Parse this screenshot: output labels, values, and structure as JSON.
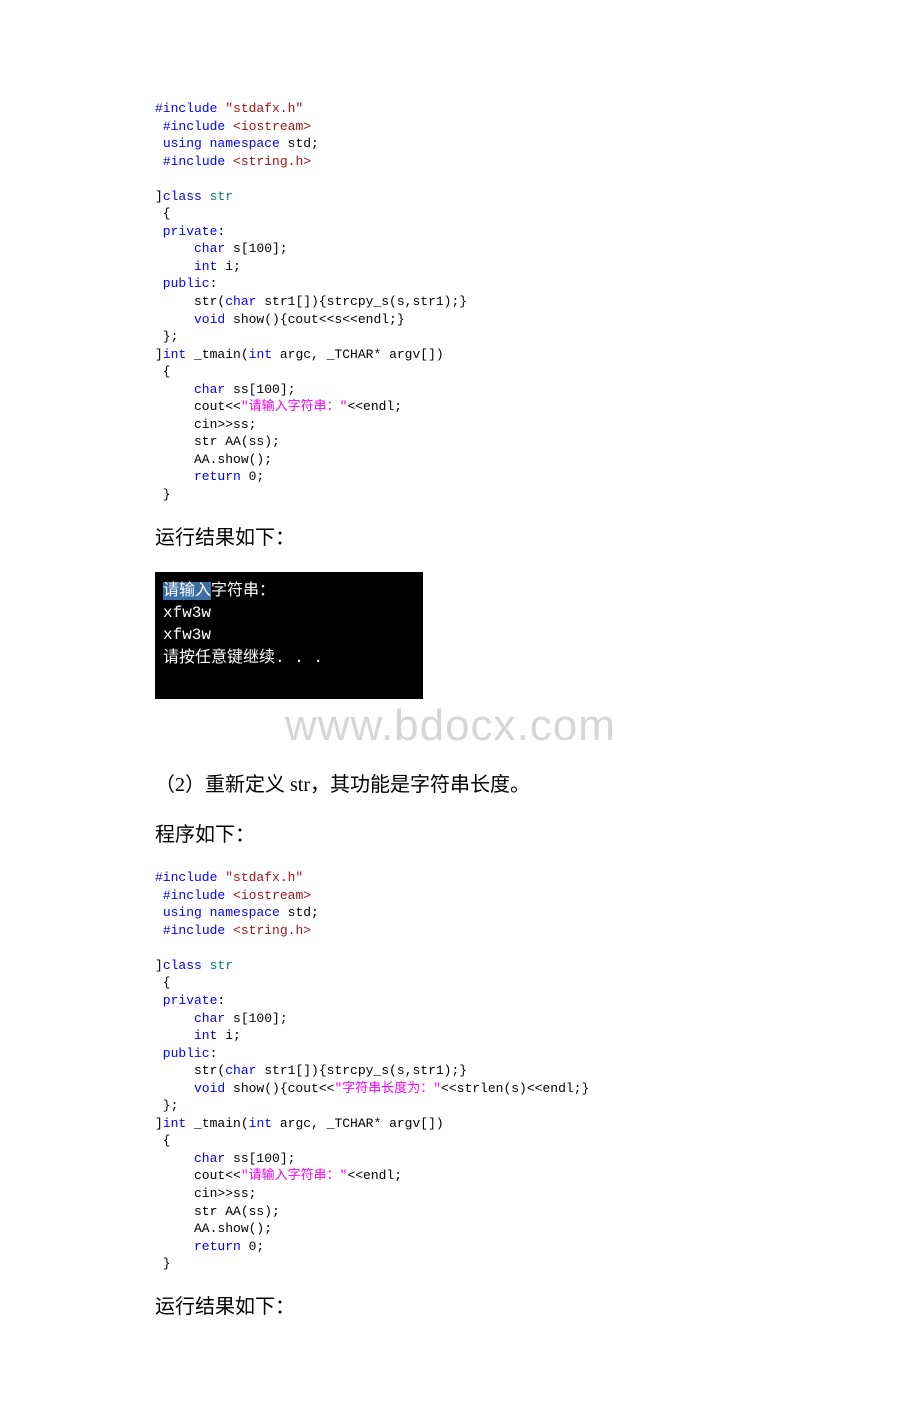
{
  "code1": {
    "l1_a": "#include",
    "l1_b": " \"stdafx.h\"",
    "l2_a": "#include",
    "l2_b": " <iostream>",
    "l3_a": "using namespace",
    "l3_b": " std;",
    "l4_a": "#include",
    "l4_b": " <string.h>",
    "l5": "",
    "l6_a": "class",
    "l6_b": " str",
    "l7": " {",
    "l8_a": " private",
    "l8_b": ":",
    "l9_a": "     char",
    "l9_b": " s[100];",
    "l10_a": "     int",
    "l10_b": " i;",
    "l11_a": " public",
    "l11_b": ":",
    "l12_a": "     str(",
    "l12_b": "char",
    "l12_c": " str1[]){strcpy_s(s,str1);}",
    "l13_a": "     void",
    "l13_b": " show(){cout<<s<<endl;}",
    "l14": " };",
    "l15_a": "int",
    "l15_b": " _tmain(",
    "l15_c": "int",
    "l15_d": " argc, _TCHAR* argv[])",
    "l16": " {",
    "l17_a": "     char",
    "l17_b": " ss[100];",
    "l18_a": "     cout<<",
    "l18_b": "\"请输入字符串：\"",
    "l18_c": "<<endl;",
    "l19": "     cin>>ss;",
    "l20": "     str AA(ss);",
    "l21": "     AA.show();",
    "l22_a": "     return",
    "l22_b": " 0;",
    "l23": " }"
  },
  "para1": "运行结果如下：",
  "console1": {
    "line1a": "请输入",
    "line1b": "字符串：",
    "line2": "xfw3w",
    "line3": "xfw3w",
    "line4": "请按任意键继续. . ."
  },
  "watermark": "www.bdocx.com",
  "para2": "（2）重新定义 str，其功能是字符串长度。",
  "para3": "程序如下：",
  "code2": {
    "l1_a": "#include",
    "l1_b": " \"stdafx.h\"",
    "l2_a": "#include",
    "l2_b": " <iostream>",
    "l3_a": "using namespace",
    "l3_b": " std;",
    "l4_a": "#include",
    "l4_b": " <string.h>",
    "l5": "",
    "l6_a": "class",
    "l6_b": " str",
    "l7": " {",
    "l8_a": " private",
    "l8_b": ":",
    "l9_a": "     char",
    "l9_b": " s[100];",
    "l10_a": "     int",
    "l10_b": " i;",
    "l11_a": " public",
    "l11_b": ":",
    "l12_a": "     str(",
    "l12_b": "char",
    "l12_c": " str1[]){strcpy_s(s,str1);}",
    "l13_a": "     void",
    "l13_b": " show(){cout<<",
    "l13_c": "\"字符串长度为：\"",
    "l13_d": "<<strlen(s)<<endl;}",
    "l14": " };",
    "l15_a": "int",
    "l15_b": " _tmain(",
    "l15_c": "int",
    "l15_d": " argc, _TCHAR* argv[])",
    "l16": " {",
    "l17_a": "     char",
    "l17_b": " ss[100];",
    "l18_a": "     cout<<",
    "l18_b": "\"请输入字符串：\"",
    "l18_c": "<<endl;",
    "l19": "     cin>>ss;",
    "l20": "     str AA(ss);",
    "l21": "     AA.show();",
    "l22_a": "     return",
    "l22_b": " 0;",
    "l23": " }"
  },
  "para4": "运行结果如下："
}
